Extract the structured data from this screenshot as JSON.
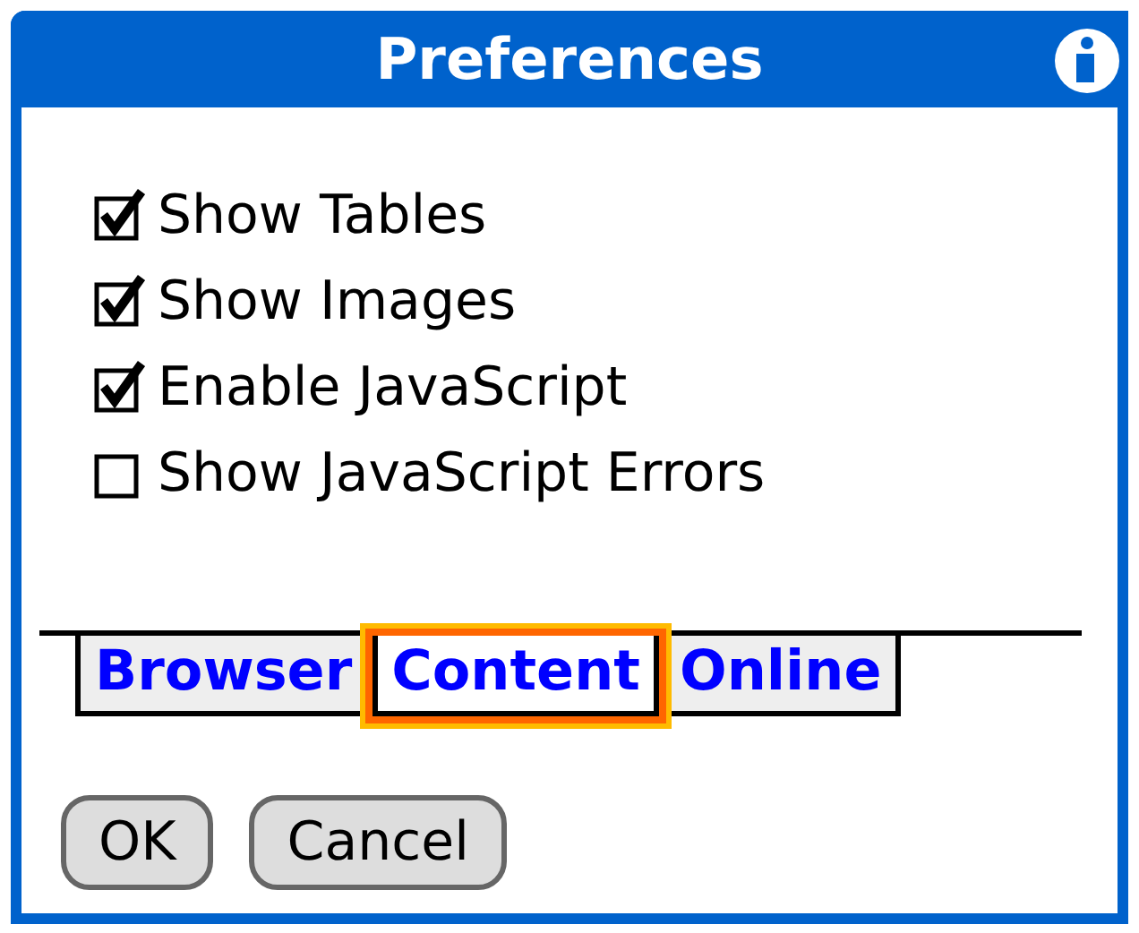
{
  "window": {
    "title": "Preferences"
  },
  "options": [
    {
      "label": "Show Tables",
      "checked": true
    },
    {
      "label": "Show Images",
      "checked": true
    },
    {
      "label": "Enable JavaScript",
      "checked": true
    },
    {
      "label": "Show JavaScript Errors",
      "checked": false
    }
  ],
  "tabs": [
    {
      "label": "Browser",
      "selected": false
    },
    {
      "label": "Content",
      "selected": true
    },
    {
      "label": "Online",
      "selected": false
    }
  ],
  "buttons": [
    {
      "label": "OK"
    },
    {
      "label": "Cancel"
    }
  ]
}
